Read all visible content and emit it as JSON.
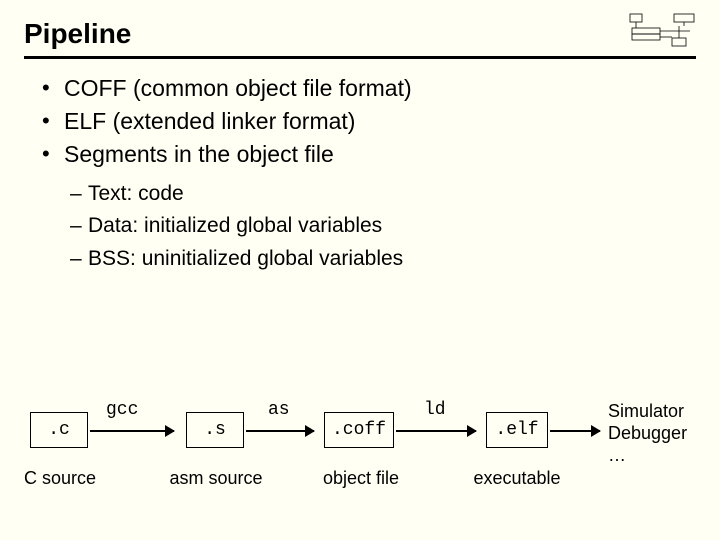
{
  "title": "Pipeline",
  "bullets": {
    "b1": "COFF (common object file format)",
    "b2": "ELF (extended linker format)",
    "b3": "Segments in the object file"
  },
  "sub": {
    "s1": "Text: code",
    "s2": "Data: initialized global variables",
    "s3": "BSS: uninitialized global variables"
  },
  "diagram": {
    "boxes": {
      "c": ".c",
      "s": ".s",
      "coff": ".coff",
      "elf": ".elf"
    },
    "tools": {
      "gcc": "gcc",
      "as": "as",
      "ld": "ld"
    },
    "captions": {
      "csrc": "C source",
      "asm": "asm source",
      "obj": "object file",
      "exe": "executable"
    },
    "end1": "Simulator",
    "end2": "Debugger",
    "end3": "…"
  }
}
